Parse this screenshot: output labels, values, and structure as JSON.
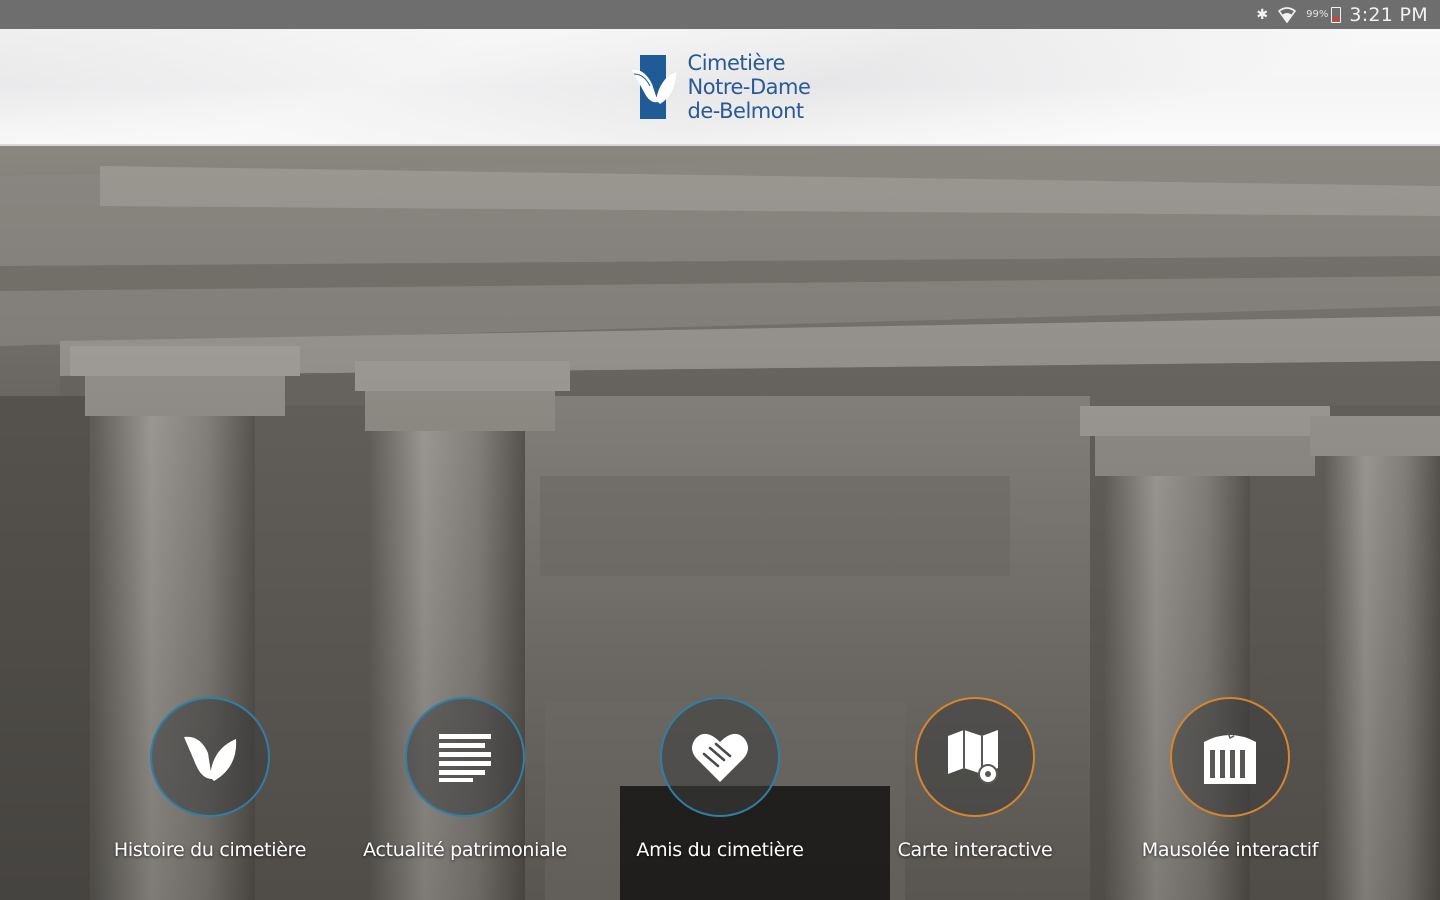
{
  "status_bar": {
    "bluetooth_icon": "bluetooth-icon",
    "wifi_icon": "wifi-icon",
    "battery_percent": "99%",
    "battery_icon": "battery-icon",
    "time": "3:21 PM"
  },
  "header": {
    "logo": {
      "line1": "Cimetière",
      "line2": "Notre-Dame",
      "line3": "de-Belmont"
    }
  },
  "menu": [
    {
      "label": "Histoire du cimetière",
      "icon": "leaf-icon",
      "accent": "#2f7fa6"
    },
    {
      "label": "Actualité patrimoniale",
      "icon": "text-lines-icon",
      "accent": "#2f7fa6"
    },
    {
      "label": "Amis du cimetière",
      "icon": "heart-handshake-icon",
      "accent": "#2f7fa6"
    },
    {
      "label": "Carte interactive",
      "icon": "map-icon",
      "accent": "#d7862b"
    },
    {
      "label": "Mausolée interactif",
      "icon": "mausoleum-icon",
      "accent": "#d7862b"
    }
  ],
  "colors": {
    "status_bar": "#6e6e6e",
    "brand_blue": "#2a5a93",
    "accent_blue": "#2f7fa6",
    "accent_orange": "#d7862b"
  }
}
